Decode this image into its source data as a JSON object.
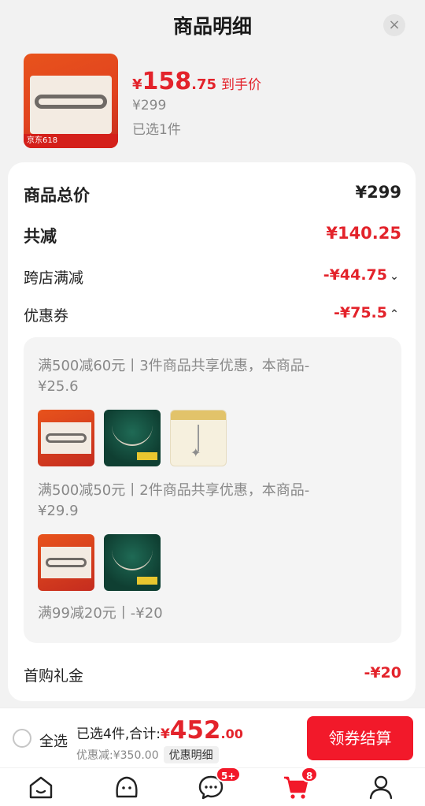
{
  "header": {
    "title": "商品明细",
    "close_label": "×"
  },
  "product": {
    "price_yen": "¥",
    "price_int": "158",
    "price_dec": ".75",
    "price_tag": "到手价",
    "original_price": "¥299",
    "selected_count": "已选1件",
    "thumb_strip": "京东618"
  },
  "summary": {
    "total_label": "商品总价",
    "total_value": "¥299",
    "reduce_label": "共减",
    "reduce_value": "¥140.25",
    "cross_label": "跨店满减",
    "cross_value": "-¥44.75",
    "coupon_label": "优惠券",
    "coupon_value": "-¥75.5",
    "gift_label": "首购礼金",
    "gift_value": "-¥20"
  },
  "coupons": [
    {
      "text": "满500减60元丨3件商品共享优惠，本商品-¥25.6"
    },
    {
      "text": "满500减50元丨2件商品共享优惠，本商品-¥29.9"
    },
    {
      "text": "满99减20元丨-¥20"
    }
  ],
  "bottom": {
    "select_all": "全选",
    "sum_prefix": "已选4件,合计:",
    "sum_yen": "¥",
    "sum_int": "452",
    "sum_dec": ".00",
    "saved": "优惠减:¥350.00",
    "detail": "优惠明细",
    "checkout": "领券结算"
  },
  "tabbar": {
    "messages_badge": "5+",
    "cart_badge": "8"
  },
  "colors": {
    "accent": "#e3232b",
    "checkout_bg": "#f2192a"
  }
}
